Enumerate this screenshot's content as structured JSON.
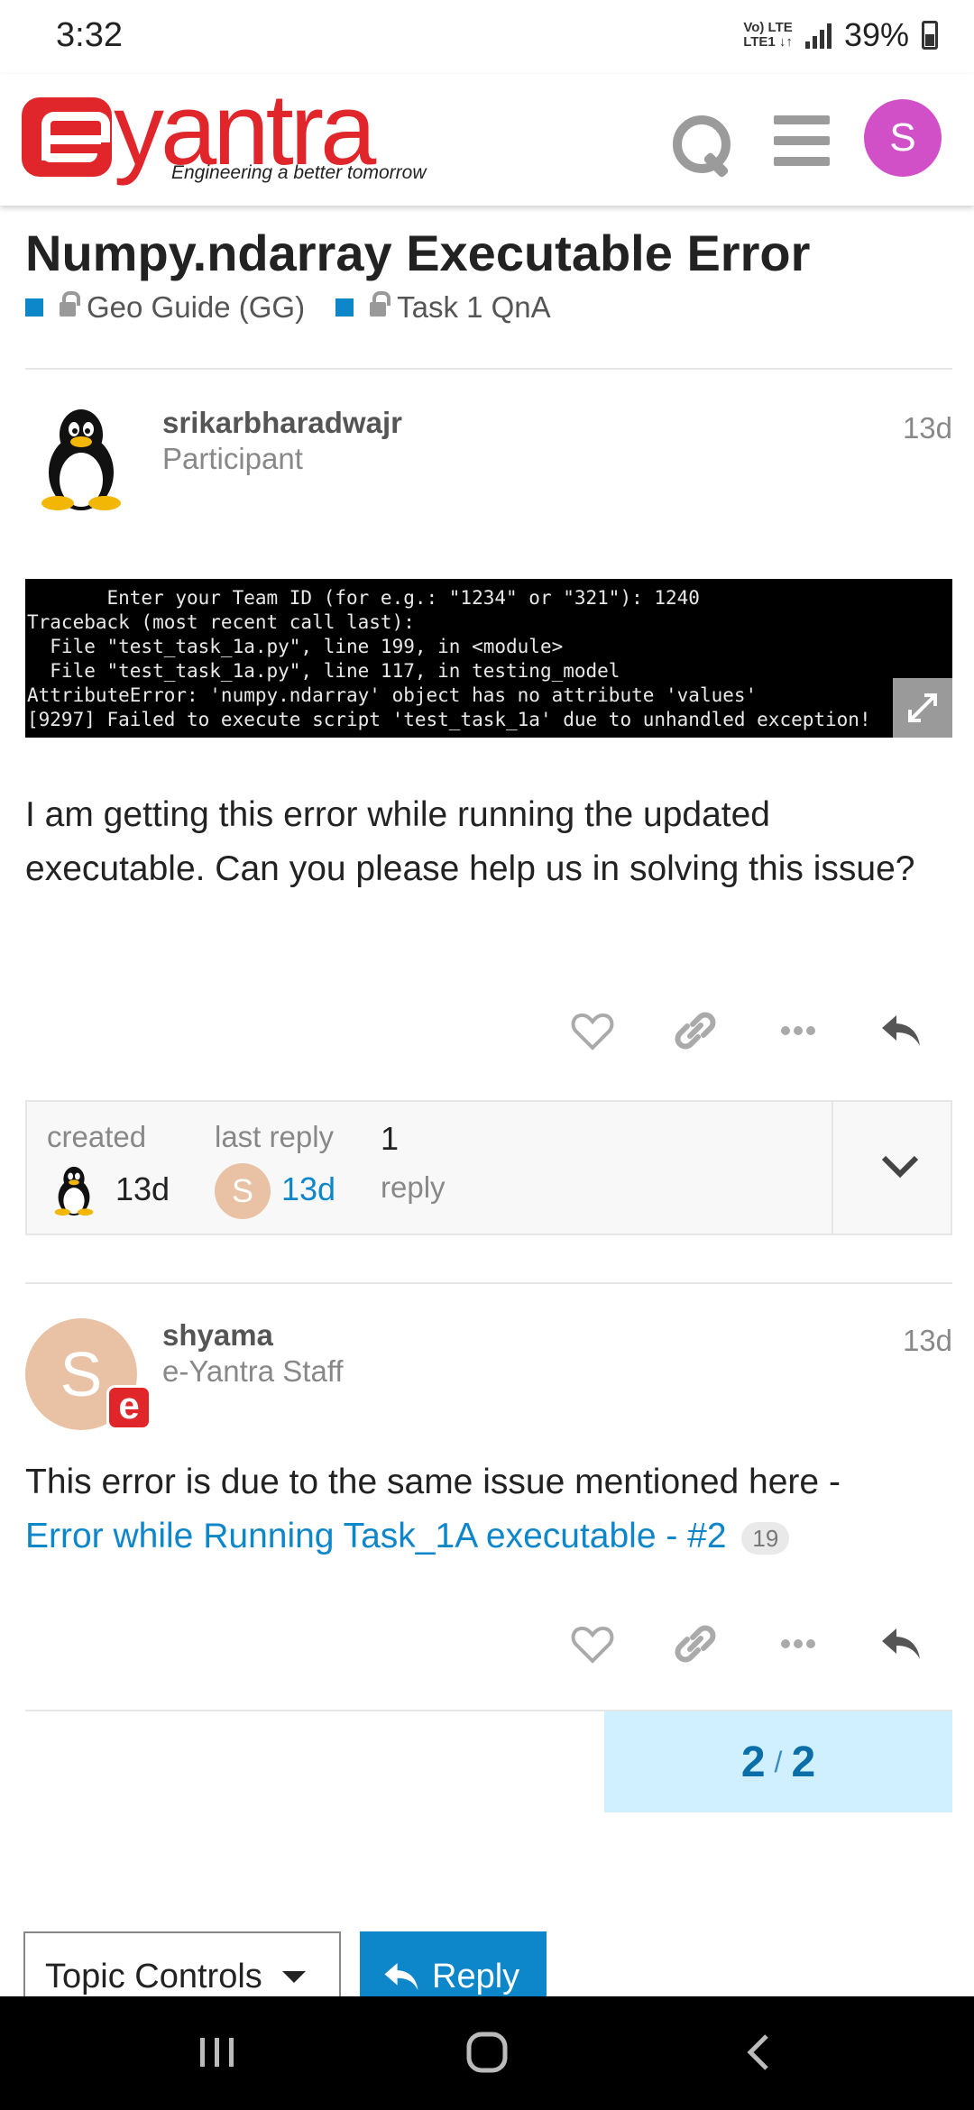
{
  "status_bar": {
    "time": "3:32",
    "network_top": "Vo) LTE",
    "network_bottom": "LTE1 ↓↑",
    "battery": "39%"
  },
  "header": {
    "logo_text": "yantra",
    "logo_tagline": "Engineering a better tomorrow",
    "user_initial": "S",
    "avatar_color": "#d150c8"
  },
  "topic": {
    "title": "Numpy.ndarray Executable Error",
    "categories": [
      {
        "label": "Geo Guide (GG)",
        "color": "#0e86ca",
        "locked": true
      },
      {
        "label": "Task 1 QnA",
        "color": "#0e86ca",
        "locked": true
      }
    ]
  },
  "posts": [
    {
      "username": "srikarbharadwajr",
      "user_title": "Participant",
      "date": "13d",
      "avatar": "tux-penguin-icon",
      "terminal_lines": [
        "       Enter your Team ID (for e.g.: \"1234\" or \"321\"): 1240",
        "Traceback (most recent call last):",
        "  File \"test_task_1a.py\", line 199, in <module>",
        "  File \"test_task_1a.py\", line 117, in testing_model",
        "AttributeError: 'numpy.ndarray' object has no attribute 'values'",
        "[9297] Failed to execute script 'test_task_1a' due to unhandled exception!"
      ],
      "body": "I am getting this error while running the updated executable. Can you please help us in solving this issue?"
    },
    {
      "username": "shyama",
      "user_title": "e-Yantra Staff",
      "date": "13d",
      "avatar_initial": "S",
      "badge": "e",
      "body_text": "This error is due to the same issue mentioned here -",
      "link_text": "Error while Running Task_1A executable - #2",
      "link_count": "19"
    }
  ],
  "topic_map": {
    "created_label": "created",
    "created_value": "13d",
    "last_reply_label": "last reply",
    "last_reply_initial": "S",
    "last_reply_value": "13d",
    "replies_count": "1",
    "replies_label": "reply"
  },
  "progress": {
    "current": "2",
    "separator": "/",
    "total": "2"
  },
  "footer": {
    "topic_controls_label": "Topic Controls",
    "reply_label": "Reply"
  },
  "colors": {
    "brand_red": "#e0262b",
    "link_blue": "#0e86ca",
    "progress_bg": "#d1f0ff"
  }
}
